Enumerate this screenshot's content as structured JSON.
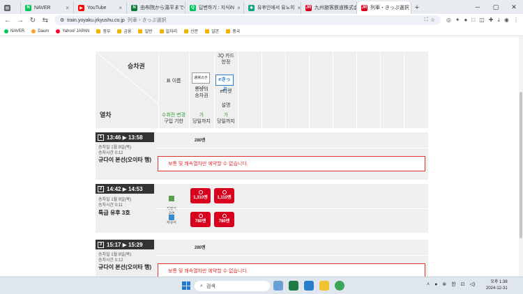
{
  "browser": {
    "tabs": [
      {
        "title": "",
        "icon": "google-sheets-icon",
        "color": "#5f6368"
      },
      {
        "title": "NAVER",
        "icon": "naver-icon",
        "color": "#03c75a"
      },
      {
        "title": "YouTube",
        "icon": "youtube-icon",
        "color": "#ff0000"
      },
      {
        "title": "由布院から湯平までの",
        "icon": "n-icon",
        "color": "#0f7a3c"
      },
      {
        "title": "답변하기 : 지식iN",
        "icon": "naver-kin-icon",
        "color": "#03c75a"
      },
      {
        "title": "유후인에서 유노히",
        "icon": "chatgpt-icon",
        "color": "#10a37f"
      },
      {
        "title": "九州旅客鉄道株式会",
        "icon": "jr-icon",
        "color": "#d8001c"
      },
      {
        "title": "列車・きっぷ選択",
        "icon": "jr-icon",
        "color": "#d8001c"
      }
    ],
    "url": "train.yoyaku.jrkyushu.co.jp",
    "url_title": "列車・きっぷ選択",
    "bookmarks": [
      {
        "label": "NAVER",
        "color": "#03c75a"
      },
      {
        "label": "Daum",
        "color": "#f5a623"
      },
      {
        "label": "Yahoo! JAPAN",
        "color": "#ff0033"
      },
      {
        "label": "정부",
        "color": "#f0b400"
      },
      {
        "label": "금융",
        "color": "#f0b400"
      },
      {
        "label": "일반",
        "color": "#f0b400"
      },
      {
        "label": "일자리",
        "color": "#f0b400"
      },
      {
        "label": "신문",
        "color": "#f0b400"
      },
      {
        "label": "일본",
        "color": "#f0b400"
      },
      {
        "label": "중국",
        "color": "#f0b400"
      }
    ]
  },
  "table": {
    "seat_header": "승차권",
    "train_header": "열차",
    "ticket_name_label": "표 이름",
    "jq_card_label": "JQ 카드\n한정",
    "normal_ticket": "통상의\n승차권",
    "normal_ticket_img": "通常のきっぷ",
    "eticket": "e티켓",
    "eticket_img": "eきっぷ",
    "description_label": "설명",
    "change_before": "수취전 변경",
    "purchase_deadline": "구입 기한",
    "change_ok1": "가",
    "until1": "당일까지",
    "change_ok2": "가",
    "until2": "당일까지"
  },
  "trains": [
    {
      "num": "1",
      "time": "13:46 ▶ 13:58",
      "date": "승차일 1월 9일(목)",
      "duration": "승차시간 0:12",
      "name": "규다이 본선(오이타 행)",
      "price": "280엔",
      "notice": "보통 및 쾌속열차만 예약할 수 없습니다."
    },
    {
      "num": "2",
      "time": "14:42 ▶ 14:53",
      "date": "승차일 1월 9일(목)",
      "duration": "승차시간 0:11",
      "name": "특급 유후 3호",
      "reserved_label": "지정석\n금연",
      "free_label": "자유석",
      "reserved_price1": "1,310엔",
      "reserved_price2": "1,110엔",
      "free_price1": "780엔",
      "free_price2": "780엔"
    },
    {
      "num": "3",
      "time": "15:17 ▶ 15:29",
      "date": "승차일 1월 9일(목)",
      "duration": "승차시간 0:12",
      "name": "규다이 본선(오이타 행)",
      "price": "280엔",
      "notice": "보통 및 쾌속열차만 예약할 수 없습니다."
    }
  ],
  "taskbar": {
    "search_placeholder": "검색",
    "ime": "한",
    "time": "오후 1:38",
    "date": "2024-12-31"
  },
  "colors": {
    "accent_red": "#d8001c",
    "notice_red": "#dd3333",
    "green_text": "#3a9a3a"
  }
}
